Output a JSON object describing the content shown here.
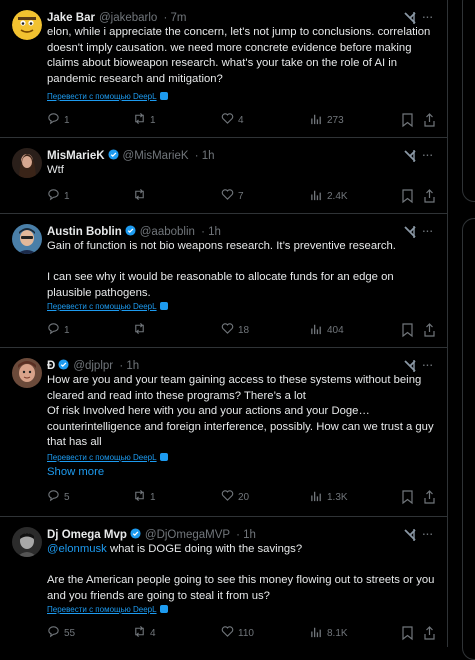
{
  "translate_label": "Перевести с помощью DeepL",
  "show_more_label": "Show more",
  "colors": {
    "accent": "#1d9bf0",
    "muted": "#71767b",
    "text": "#e7e9ea",
    "border": "#2f3336",
    "background": "#000000"
  },
  "tweets": [
    {
      "name": "Jake Bar",
      "handle": "@jakebarlo",
      "time": "· 7m",
      "verified": false,
      "text": "elon, while i appreciate the concern, let's not jump to conclusions. correlation doesn't imply causation. we need more concrete evidence before making claims about bioweapon research. what's your take on the role of AI in pandemic research and mitigation?",
      "replies": "1",
      "reposts": "1",
      "likes": "4",
      "views": "273"
    },
    {
      "name": "MisMarieK",
      "handle": "@MisMarieK",
      "time": "· 1h",
      "verified": true,
      "text": "Wtf",
      "replies": "1",
      "reposts": "",
      "likes": "7",
      "views": "2.4K"
    },
    {
      "name": "Austin Boblin",
      "handle": "@aaboblin",
      "time": "· 1h",
      "verified": true,
      "text": "Gain of function is not bio weapons research. It’s preventive research.\n\nI can see why it would be reasonable to allocate funds for an edge on plausible pathogens.",
      "replies": "1",
      "reposts": "",
      "likes": "18",
      "views": "404"
    },
    {
      "name": "Ð",
      "handle": "@djplpr",
      "time": "· 1h",
      "verified": true,
      "text": "How are you and your team gaining access to these systems without being cleared and read into these programs? There’s a lot\nOf risk Involved here with you and your actions and your Doge… counterintelligence and foreign interference, possibly. How can we trust a guy that has all",
      "replies": "5",
      "reposts": "1",
      "likes": "20",
      "views": "1.3K"
    },
    {
      "name": "Dj Omega Mvp",
      "handle": "@DjOmegaMVP",
      "time": "· 1h",
      "verified": true,
      "mention": "@elonmusk",
      "text": " what is DOGE doing with the savings?\n\nAre the American people going to see this money flowing out to streets or you and you friends are going to steal it from us?",
      "replies": "55",
      "reposts": "4",
      "likes": "110",
      "views": "8.1K"
    }
  ]
}
